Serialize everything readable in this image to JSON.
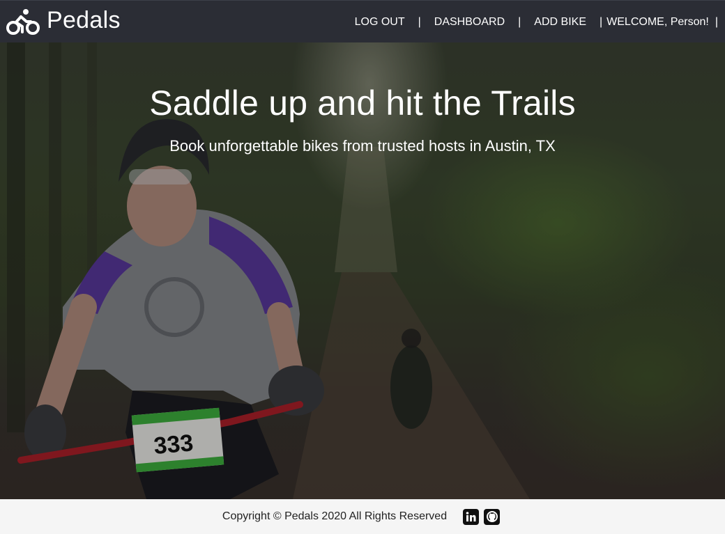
{
  "brand": {
    "name": "Pedals",
    "icon": "bicycle-icon"
  },
  "nav": {
    "logout": "LOG OUT",
    "dashboard": "DASHBOARD",
    "add_bike": "ADD BIKE",
    "welcome": "WELCOME, Person!",
    "separator": "|"
  },
  "hero": {
    "title": "Saddle up and hit the Trails",
    "subtitle": "Book unforgettable bikes from trusted hosts in Austin, TX",
    "race_number": "333"
  },
  "footer": {
    "copyright": "Copyright © Pedals 2020 All Rights Reserved",
    "linkedin_icon": "linkedin-icon",
    "github_icon": "github-icon"
  },
  "colors": {
    "navbar_bg": "#2b2d35",
    "footer_bg": "#f5f5f5",
    "text_light": "#ffffff"
  }
}
